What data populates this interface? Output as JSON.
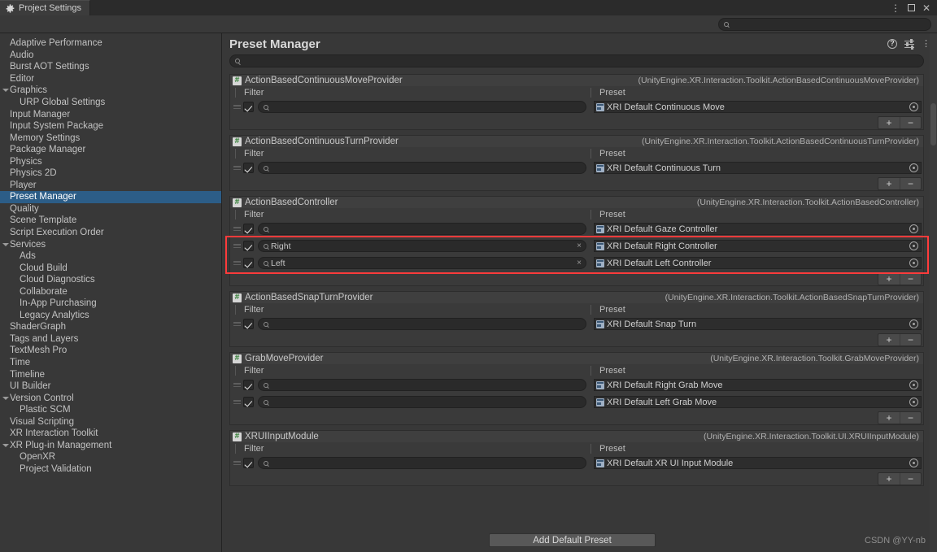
{
  "window": {
    "tab_title": "Project Settings",
    "gear_icon": "gear-icon",
    "controls": {
      "menu": "⋮",
      "maximize": "",
      "close": "✕"
    }
  },
  "toolbar": {
    "search_placeholder": "",
    "search_value": "",
    "search_icon": "search-icon"
  },
  "sidebar": {
    "items": [
      {
        "label": "Adaptive Performance",
        "level": 0,
        "expander": false,
        "selected": false
      },
      {
        "label": "Audio",
        "level": 0,
        "expander": false,
        "selected": false
      },
      {
        "label": "Burst AOT Settings",
        "level": 0,
        "expander": false,
        "selected": false
      },
      {
        "label": "Editor",
        "level": 0,
        "expander": false,
        "selected": false
      },
      {
        "label": "Graphics",
        "level": 0,
        "expander": true,
        "selected": false
      },
      {
        "label": "URP Global Settings",
        "level": 1,
        "expander": false,
        "selected": false
      },
      {
        "label": "Input Manager",
        "level": 0,
        "expander": false,
        "selected": false
      },
      {
        "label": "Input System Package",
        "level": 0,
        "expander": false,
        "selected": false
      },
      {
        "label": "Memory Settings",
        "level": 0,
        "expander": false,
        "selected": false
      },
      {
        "label": "Package Manager",
        "level": 0,
        "expander": false,
        "selected": false
      },
      {
        "label": "Physics",
        "level": 0,
        "expander": false,
        "selected": false
      },
      {
        "label": "Physics 2D",
        "level": 0,
        "expander": false,
        "selected": false
      },
      {
        "label": "Player",
        "level": 0,
        "expander": false,
        "selected": false
      },
      {
        "label": "Preset Manager",
        "level": 0,
        "expander": false,
        "selected": true
      },
      {
        "label": "Quality",
        "level": 0,
        "expander": false,
        "selected": false
      },
      {
        "label": "Scene Template",
        "level": 0,
        "expander": false,
        "selected": false
      },
      {
        "label": "Script Execution Order",
        "level": 0,
        "expander": false,
        "selected": false
      },
      {
        "label": "Services",
        "level": 0,
        "expander": true,
        "selected": false
      },
      {
        "label": "Ads",
        "level": 1,
        "expander": false,
        "selected": false
      },
      {
        "label": "Cloud Build",
        "level": 1,
        "expander": false,
        "selected": false
      },
      {
        "label": "Cloud Diagnostics",
        "level": 1,
        "expander": false,
        "selected": false
      },
      {
        "label": "Collaborate",
        "level": 1,
        "expander": false,
        "selected": false
      },
      {
        "label": "In-App Purchasing",
        "level": 1,
        "expander": false,
        "selected": false
      },
      {
        "label": "Legacy Analytics",
        "level": 1,
        "expander": false,
        "selected": false
      },
      {
        "label": "ShaderGraph",
        "level": 0,
        "expander": false,
        "selected": false
      },
      {
        "label": "Tags and Layers",
        "level": 0,
        "expander": false,
        "selected": false
      },
      {
        "label": "TextMesh Pro",
        "level": 0,
        "expander": false,
        "selected": false
      },
      {
        "label": "Time",
        "level": 0,
        "expander": false,
        "selected": false
      },
      {
        "label": "Timeline",
        "level": 0,
        "expander": false,
        "selected": false
      },
      {
        "label": "UI Builder",
        "level": 0,
        "expander": false,
        "selected": false
      },
      {
        "label": "Version Control",
        "level": 0,
        "expander": true,
        "selected": false
      },
      {
        "label": "Plastic SCM",
        "level": 1,
        "expander": false,
        "selected": false
      },
      {
        "label": "Visual Scripting",
        "level": 0,
        "expander": false,
        "selected": false
      },
      {
        "label": "XR Interaction Toolkit",
        "level": 0,
        "expander": false,
        "selected": false
      },
      {
        "label": "XR Plug-in Management",
        "level": 0,
        "expander": true,
        "selected": false
      },
      {
        "label": "OpenXR",
        "level": 1,
        "expander": false,
        "selected": false
      },
      {
        "label": "Project Validation",
        "level": 1,
        "expander": false,
        "selected": false
      }
    ]
  },
  "main": {
    "title": "Preset Manager",
    "help_icon": "help-icon",
    "preferences_icon": "settings-sliders-icon",
    "menu_icon": "kebab-menu-icon",
    "search_value": "",
    "column_headers": {
      "filter": "Filter",
      "preset": "Preset"
    },
    "add_remove": {
      "add": "+",
      "remove": "−"
    },
    "groups": [
      {
        "name": "ActionBasedContinuousMoveProvider",
        "type": "(UnityEngine.XR.Interaction.Toolkit.ActionBasedContinuousMoveProvider)",
        "rows": [
          {
            "checked": true,
            "filter": "",
            "preset": "XRI Default Continuous Move",
            "highlighted": false
          }
        ]
      },
      {
        "name": "ActionBasedContinuousTurnProvider",
        "type": "(UnityEngine.XR.Interaction.Toolkit.ActionBasedContinuousTurnProvider)",
        "rows": [
          {
            "checked": true,
            "filter": "",
            "preset": "XRI Default Continuous Turn",
            "highlighted": false
          }
        ]
      },
      {
        "name": "ActionBasedController",
        "type": "(UnityEngine.XR.Interaction.Toolkit.ActionBasedController)",
        "rows": [
          {
            "checked": true,
            "filter": "",
            "preset": "XRI Default Gaze Controller",
            "highlighted": false
          },
          {
            "checked": true,
            "filter": "Right",
            "preset": "XRI Default Right Controller",
            "highlighted": true
          },
          {
            "checked": true,
            "filter": "Left",
            "preset": "XRI Default Left Controller",
            "highlighted": true
          }
        ]
      },
      {
        "name": "ActionBasedSnapTurnProvider",
        "type": "(UnityEngine.XR.Interaction.Toolkit.ActionBasedSnapTurnProvider)",
        "rows": [
          {
            "checked": true,
            "filter": "",
            "preset": "XRI Default Snap Turn",
            "highlighted": false
          }
        ]
      },
      {
        "name": "GrabMoveProvider",
        "type": "(UnityEngine.XR.Interaction.Toolkit.GrabMoveProvider)",
        "rows": [
          {
            "checked": true,
            "filter": "",
            "preset": "XRI Default Right Grab Move",
            "highlighted": false
          },
          {
            "checked": true,
            "filter": "",
            "preset": "XRI Default Left Grab Move",
            "highlighted": false
          }
        ]
      },
      {
        "name": "XRUIInputModule",
        "type": "(UnityEngine.XR.Interaction.Toolkit.UI.XRUIInputModule)",
        "rows": [
          {
            "checked": true,
            "filter": "",
            "preset": "XRI Default XR UI Input Module",
            "highlighted": false
          }
        ]
      }
    ]
  },
  "footer": {
    "add_default_preset": "Add Default Preset",
    "watermark": "CSDN @YY-nb"
  }
}
